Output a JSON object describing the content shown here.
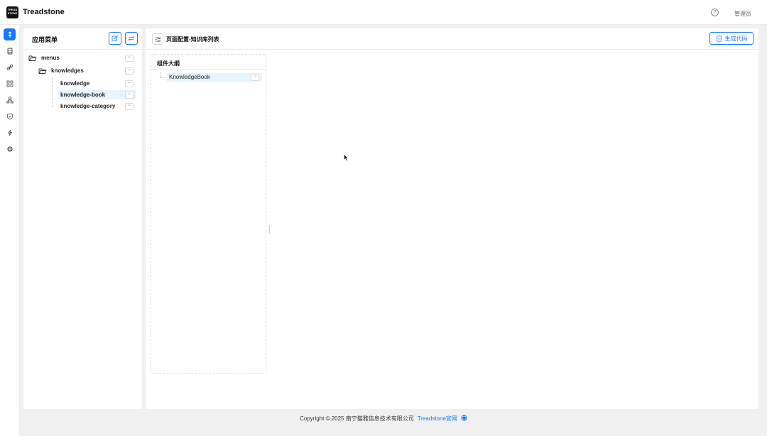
{
  "header": {
    "logo_lines": [
      "TREAD",
      "STONE"
    ],
    "app_name": "Treadstone",
    "help_icon": "question-circle-icon",
    "user": "管理员"
  },
  "rail": {
    "items": [
      {
        "icon": "pin-icon",
        "active": true
      },
      {
        "icon": "database-icon",
        "active": false
      },
      {
        "icon": "link-icon",
        "active": false
      },
      {
        "icon": "appstore-icon",
        "active": false
      },
      {
        "icon": "cluster-icon",
        "active": false
      },
      {
        "icon": "shield-check-icon",
        "active": false
      },
      {
        "icon": "thunderbolt-icon",
        "active": false
      },
      {
        "icon": "gear-icon",
        "active": false
      }
    ]
  },
  "menu_panel": {
    "title": "应用菜单",
    "tree": [
      {
        "label": "menus",
        "more": "···"
      },
      {
        "label": "knowledges",
        "more": "···"
      },
      {
        "label": "knowledge",
        "more": "···"
      },
      {
        "label": "knowledge-book",
        "more": "···",
        "selected": true
      },
      {
        "label": "knowledge-category",
        "more": "···"
      }
    ]
  },
  "main": {
    "title": "页面配置-知识库列表",
    "generate_button": "生成代码",
    "outline": {
      "title": "组件大纲",
      "node": "KnowledgeBook",
      "node_more": "···"
    }
  },
  "footer": {
    "copyright": "Copyright © 2025 南宁猫雅信息技术有限公司",
    "link": "Treadstone官网"
  },
  "colors": {
    "accent": "#1677ff",
    "selected_bg": "#e6f4ff",
    "page_bg": "#f0f0f0"
  }
}
